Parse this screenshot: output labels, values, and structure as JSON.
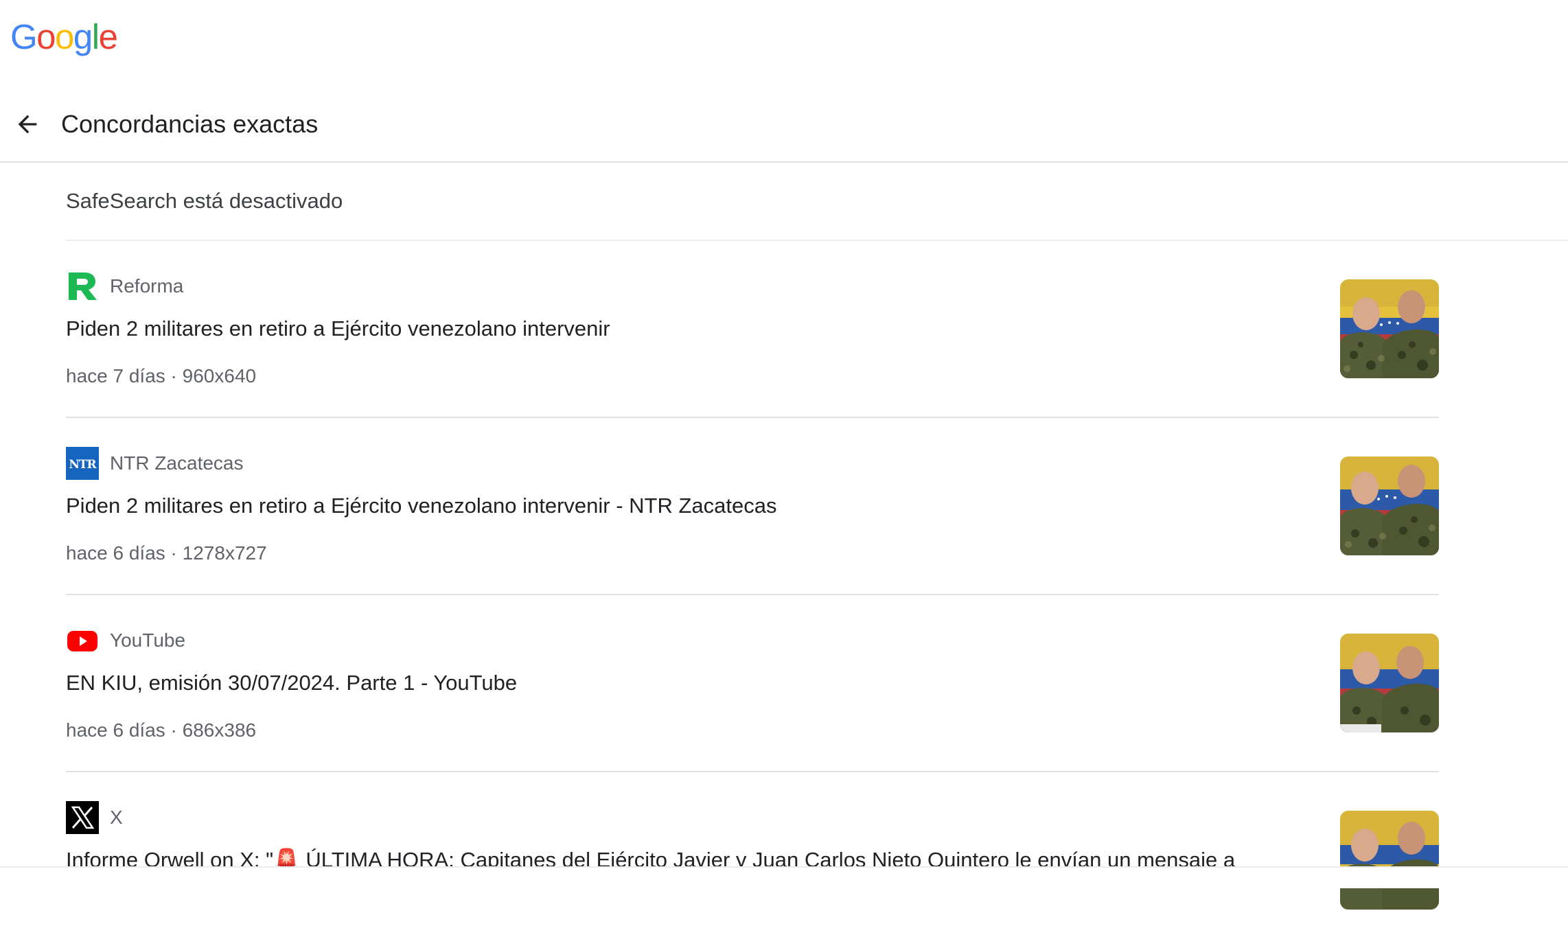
{
  "brand": {
    "letters": [
      {
        "char": "G",
        "color": "#4285F4"
      },
      {
        "char": "o",
        "color": "#EA4335"
      },
      {
        "char": "o",
        "color": "#FBBC05"
      },
      {
        "char": "g",
        "color": "#4285F4"
      },
      {
        "char": "l",
        "color": "#34A853"
      },
      {
        "char": "e",
        "color": "#EA4335"
      }
    ]
  },
  "header": {
    "back_icon": "arrow-back-icon",
    "title": "Concordancias exactas"
  },
  "safesearch": {
    "label": "SafeSearch está desactivado"
  },
  "results": [
    {
      "source": "Reforma",
      "icon": "reforma-logo-icon",
      "title": "Piden 2 militares en retiro a Ejército venezolano intervenir",
      "meta": "hace 7 días · 960x640"
    },
    {
      "source": "NTR Zacatecas",
      "icon": "ntr-logo-icon",
      "title": "Piden 2 militares en retiro a Ejército venezolano intervenir - NTR Zacatecas",
      "meta": "hace 6 días · 1278x727"
    },
    {
      "source": "YouTube",
      "icon": "youtube-logo-icon",
      "title": "EN KIU, emisión 30/07/2024. Parte 1 - YouTube",
      "meta": "hace 6 días · 686x386"
    },
    {
      "source": "X",
      "icon": "x-logo-icon",
      "title": "Informe Orwell on X: \"🚨 ÚLTIMA HORA: Capitanes del Ejército Javier y Juan Carlos Nieto Quintero le envían un mensaje a",
      "meta": ""
    }
  ],
  "colors": {
    "reforma_green": "#1DB954",
    "ntr_blue": "#1565C0",
    "youtube_red": "#FF0000"
  }
}
